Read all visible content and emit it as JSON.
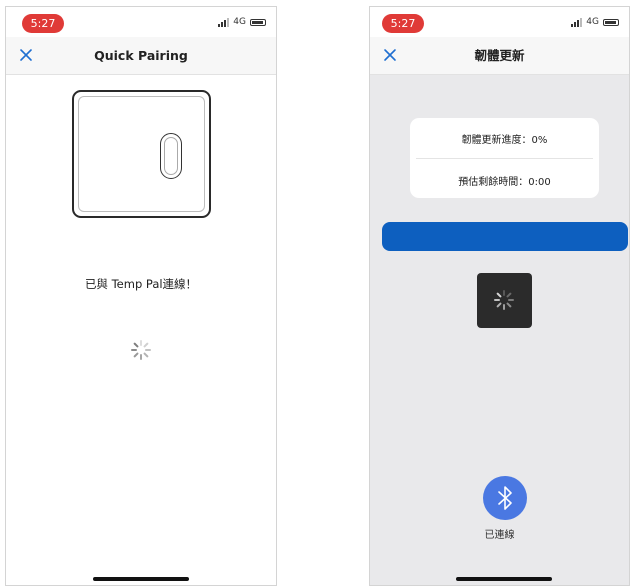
{
  "left_screen": {
    "status": {
      "time": "5:27",
      "network": "4G"
    },
    "nav": {
      "title": "Quick Pairing"
    },
    "connected_message": "已與 Temp Pal連線！"
  },
  "right_screen": {
    "status": {
      "time": "5:27",
      "network": "4G"
    },
    "nav": {
      "title": "韌體更新"
    },
    "progress_card": {
      "progress_text": "韌體更新進度：0%",
      "remaining_text": "預估剩餘時間：0:00"
    },
    "progress": {
      "fraction": 0
    },
    "bluetooth": {
      "label": "已連線"
    }
  },
  "colors": {
    "status_pill": "#e03a37",
    "close_icon": "#1f6fd1",
    "progress_bar": "#0d5fbf",
    "bluetooth_button": "#4a78e2"
  }
}
